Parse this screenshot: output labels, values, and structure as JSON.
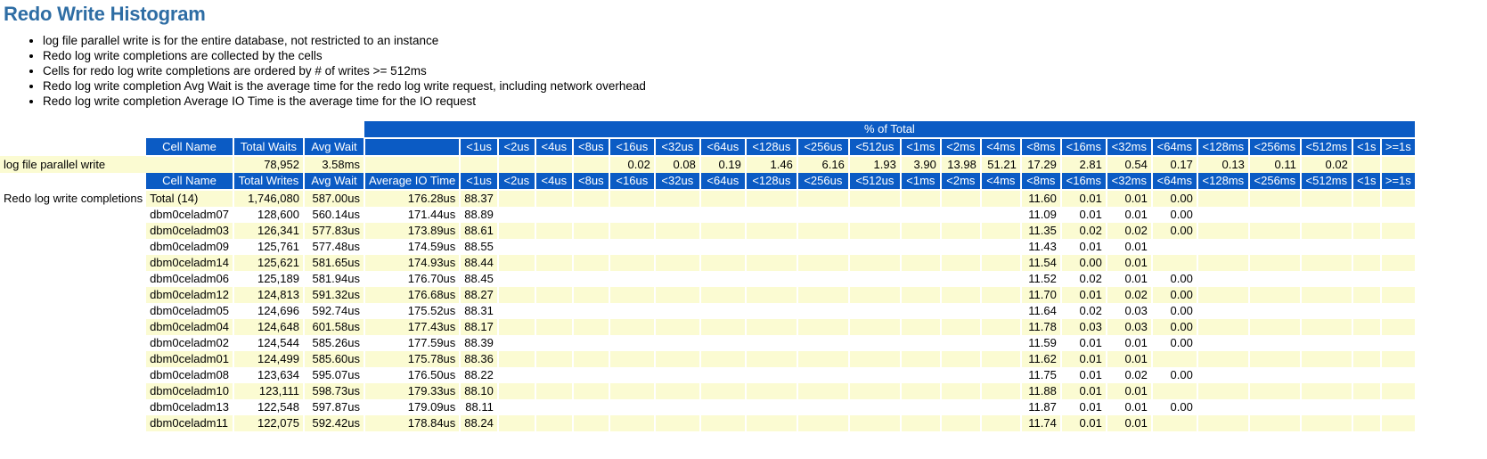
{
  "page": {
    "title": "Redo Write Histogram",
    "title_color": "#2E6DA4",
    "header_bg": "#0B5BC4",
    "row_alt_bg": "#FBFBD2"
  },
  "bullets": [
    "log file parallel write is for the entire database, not restricted to an instance",
    "Redo log write completions are collected by the cells",
    "Cells for redo log write completions are ordered by # of writes >= 512ms",
    "Redo log write completion Avg Wait is the average time for the redo log write request, including network overhead",
    "Redo log write completion Average IO Time is the average time for the IO request"
  ],
  "band": {
    "label": "% of Total"
  },
  "buckets": [
    "<1us",
    "<2us",
    "<4us",
    "<8us",
    "<16us",
    "<32us",
    "<64us",
    "<128us",
    "<256us",
    "<512us",
    "<1ms",
    "<2ms",
    "<4ms",
    "<8ms",
    "<16ms",
    "<32ms",
    "<64ms",
    "<128ms",
    "<256ms",
    "<512ms",
    "<1s",
    ">=1s"
  ],
  "table1": {
    "row_label": "log file parallel write",
    "headers": [
      "Cell Name",
      "Total Waits",
      "Avg Wait",
      ""
    ],
    "row": {
      "cell_name": "",
      "total_waits": "78,952",
      "avg_wait": "3.58ms",
      "blank": "",
      "pct": [
        "",
        "",
        "",
        "",
        "0.02",
        "0.08",
        "0.19",
        "1.46",
        "6.16",
        "1.93",
        "3.90",
        "13.98",
        "51.21",
        "17.29",
        "2.81",
        "0.54",
        "0.17",
        "0.13",
        "0.11",
        "0.02",
        "",
        ""
      ]
    }
  },
  "table2": {
    "row_label": "Redo log write completions",
    "headers": [
      "Cell Name",
      "Total Writes",
      "Avg Wait",
      "Average IO Time"
    ],
    "rows": [
      {
        "cell_name": "Total (14)",
        "total_writes": "1,746,080",
        "avg_wait": "587.00us",
        "avg_io": "176.28us",
        "pct": [
          "88.37",
          "",
          "",
          "",
          "",
          "",
          "",
          "",
          "",
          "",
          "",
          "",
          "",
          "11.60",
          "0.01",
          "0.01",
          "0.00",
          "",
          "",
          "",
          "",
          ""
        ]
      },
      {
        "cell_name": "dbm0celadm07",
        "total_writes": "128,600",
        "avg_wait": "560.14us",
        "avg_io": "171.44us",
        "pct": [
          "88.89",
          "",
          "",
          "",
          "",
          "",
          "",
          "",
          "",
          "",
          "",
          "",
          "",
          "11.09",
          "0.01",
          "0.01",
          "0.00",
          "",
          "",
          "",
          "",
          ""
        ]
      },
      {
        "cell_name": "dbm0celadm03",
        "total_writes": "126,341",
        "avg_wait": "577.83us",
        "avg_io": "173.89us",
        "pct": [
          "88.61",
          "",
          "",
          "",
          "",
          "",
          "",
          "",
          "",
          "",
          "",
          "",
          "",
          "11.35",
          "0.02",
          "0.02",
          "0.00",
          "",
          "",
          "",
          "",
          ""
        ]
      },
      {
        "cell_name": "dbm0celadm09",
        "total_writes": "125,761",
        "avg_wait": "577.48us",
        "avg_io": "174.59us",
        "pct": [
          "88.55",
          "",
          "",
          "",
          "",
          "",
          "",
          "",
          "",
          "",
          "",
          "",
          "",
          "11.43",
          "0.01",
          "0.01",
          "",
          "",
          "",
          "",
          "",
          ""
        ]
      },
      {
        "cell_name": "dbm0celadm14",
        "total_writes": "125,621",
        "avg_wait": "581.65us",
        "avg_io": "174.93us",
        "pct": [
          "88.44",
          "",
          "",
          "",
          "",
          "",
          "",
          "",
          "",
          "",
          "",
          "",
          "",
          "11.54",
          "0.00",
          "0.01",
          "",
          "",
          "",
          "",
          "",
          ""
        ]
      },
      {
        "cell_name": "dbm0celadm06",
        "total_writes": "125,189",
        "avg_wait": "581.94us",
        "avg_io": "176.70us",
        "pct": [
          "88.45",
          "",
          "",
          "",
          "",
          "",
          "",
          "",
          "",
          "",
          "",
          "",
          "",
          "11.52",
          "0.02",
          "0.01",
          "0.00",
          "",
          "",
          "",
          "",
          ""
        ]
      },
      {
        "cell_name": "dbm0celadm12",
        "total_writes": "124,813",
        "avg_wait": "591.32us",
        "avg_io": "176.68us",
        "pct": [
          "88.27",
          "",
          "",
          "",
          "",
          "",
          "",
          "",
          "",
          "",
          "",
          "",
          "",
          "11.70",
          "0.01",
          "0.02",
          "0.00",
          "",
          "",
          "",
          "",
          ""
        ]
      },
      {
        "cell_name": "dbm0celadm05",
        "total_writes": "124,696",
        "avg_wait": "592.74us",
        "avg_io": "175.52us",
        "pct": [
          "88.31",
          "",
          "",
          "",
          "",
          "",
          "",
          "",
          "",
          "",
          "",
          "",
          "",
          "11.64",
          "0.02",
          "0.03",
          "0.00",
          "",
          "",
          "",
          "",
          ""
        ]
      },
      {
        "cell_name": "dbm0celadm04",
        "total_writes": "124,648",
        "avg_wait": "601.58us",
        "avg_io": "177.43us",
        "pct": [
          "88.17",
          "",
          "",
          "",
          "",
          "",
          "",
          "",
          "",
          "",
          "",
          "",
          "",
          "11.78",
          "0.03",
          "0.03",
          "0.00",
          "",
          "",
          "",
          "",
          ""
        ]
      },
      {
        "cell_name": "dbm0celadm02",
        "total_writes": "124,544",
        "avg_wait": "585.26us",
        "avg_io": "177.59us",
        "pct": [
          "88.39",
          "",
          "",
          "",
          "",
          "",
          "",
          "",
          "",
          "",
          "",
          "",
          "",
          "11.59",
          "0.01",
          "0.01",
          "0.00",
          "",
          "",
          "",
          "",
          ""
        ]
      },
      {
        "cell_name": "dbm0celadm01",
        "total_writes": "124,499",
        "avg_wait": "585.60us",
        "avg_io": "175.78us",
        "pct": [
          "88.36",
          "",
          "",
          "",
          "",
          "",
          "",
          "",
          "",
          "",
          "",
          "",
          "",
          "11.62",
          "0.01",
          "0.01",
          "",
          "",
          "",
          "",
          "",
          ""
        ]
      },
      {
        "cell_name": "dbm0celadm08",
        "total_writes": "123,634",
        "avg_wait": "595.07us",
        "avg_io": "176.50us",
        "pct": [
          "88.22",
          "",
          "",
          "",
          "",
          "",
          "",
          "",
          "",
          "",
          "",
          "",
          "",
          "11.75",
          "0.01",
          "0.02",
          "0.00",
          "",
          "",
          "",
          "",
          ""
        ]
      },
      {
        "cell_name": "dbm0celadm10",
        "total_writes": "123,111",
        "avg_wait": "598.73us",
        "avg_io": "179.33us",
        "pct": [
          "88.10",
          "",
          "",
          "",
          "",
          "",
          "",
          "",
          "",
          "",
          "",
          "",
          "",
          "11.88",
          "0.01",
          "0.01",
          "",
          "",
          "",
          "",
          "",
          ""
        ]
      },
      {
        "cell_name": "dbm0celadm13",
        "total_writes": "122,548",
        "avg_wait": "597.87us",
        "avg_io": "179.09us",
        "pct": [
          "88.11",
          "",
          "",
          "",
          "",
          "",
          "",
          "",
          "",
          "",
          "",
          "",
          "",
          "11.87",
          "0.01",
          "0.01",
          "0.00",
          "",
          "",
          "",
          "",
          ""
        ]
      },
      {
        "cell_name": "dbm0celadm11",
        "total_writes": "122,075",
        "avg_wait": "592.42us",
        "avg_io": "178.84us",
        "pct": [
          "88.24",
          "",
          "",
          "",
          "",
          "",
          "",
          "",
          "",
          "",
          "",
          "",
          "",
          "11.74",
          "0.01",
          "0.01",
          "",
          "",
          "",
          "",
          "",
          ""
        ]
      }
    ]
  },
  "chart_data": {
    "type": "table",
    "title": "Redo Write Histogram",
    "categories": [
      "<1us",
      "<2us",
      "<4us",
      "<8us",
      "<16us",
      "<32us",
      "<64us",
      "<128us",
      "<256us",
      "<512us",
      "<1ms",
      "<2ms",
      "<4ms",
      "<8ms",
      "<16ms",
      "<32ms",
      "<64ms",
      "<128ms",
      "<256ms",
      "<512ms",
      "<1s",
      ">=1s"
    ],
    "ylabel": "% of Total",
    "series": [
      {
        "name": "log file parallel write",
        "values": [
          null,
          null,
          null,
          null,
          0.02,
          0.08,
          0.19,
          1.46,
          6.16,
          1.93,
          3.9,
          13.98,
          51.21,
          17.29,
          2.81,
          0.54,
          0.17,
          0.13,
          0.11,
          0.02,
          null,
          null
        ]
      },
      {
        "name": "Redo log write completions Total (14)",
        "values": [
          88.37,
          null,
          null,
          null,
          null,
          null,
          null,
          null,
          null,
          null,
          null,
          null,
          null,
          11.6,
          0.01,
          0.01,
          0.0,
          null,
          null,
          null,
          null,
          null
        ]
      },
      {
        "name": "dbm0celadm07",
        "values": [
          88.89,
          null,
          null,
          null,
          null,
          null,
          null,
          null,
          null,
          null,
          null,
          null,
          null,
          11.09,
          0.01,
          0.01,
          0.0,
          null,
          null,
          null,
          null,
          null
        ]
      },
      {
        "name": "dbm0celadm03",
        "values": [
          88.61,
          null,
          null,
          null,
          null,
          null,
          null,
          null,
          null,
          null,
          null,
          null,
          null,
          11.35,
          0.02,
          0.02,
          0.0,
          null,
          null,
          null,
          null,
          null
        ]
      },
      {
        "name": "dbm0celadm09",
        "values": [
          88.55,
          null,
          null,
          null,
          null,
          null,
          null,
          null,
          null,
          null,
          null,
          null,
          null,
          11.43,
          0.01,
          0.01,
          null,
          null,
          null,
          null,
          null,
          null
        ]
      },
      {
        "name": "dbm0celadm14",
        "values": [
          88.44,
          null,
          null,
          null,
          null,
          null,
          null,
          null,
          null,
          null,
          null,
          null,
          null,
          11.54,
          0.0,
          0.01,
          null,
          null,
          null,
          null,
          null,
          null
        ]
      },
      {
        "name": "dbm0celadm06",
        "values": [
          88.45,
          null,
          null,
          null,
          null,
          null,
          null,
          null,
          null,
          null,
          null,
          null,
          null,
          11.52,
          0.02,
          0.01,
          0.0,
          null,
          null,
          null,
          null,
          null
        ]
      },
      {
        "name": "dbm0celadm12",
        "values": [
          88.27,
          null,
          null,
          null,
          null,
          null,
          null,
          null,
          null,
          null,
          null,
          null,
          null,
          11.7,
          0.01,
          0.02,
          0.0,
          null,
          null,
          null,
          null,
          null
        ]
      },
      {
        "name": "dbm0celadm05",
        "values": [
          88.31,
          null,
          null,
          null,
          null,
          null,
          null,
          null,
          null,
          null,
          null,
          null,
          null,
          11.64,
          0.02,
          0.03,
          0.0,
          null,
          null,
          null,
          null,
          null
        ]
      },
      {
        "name": "dbm0celadm04",
        "values": [
          88.17,
          null,
          null,
          null,
          null,
          null,
          null,
          null,
          null,
          null,
          null,
          null,
          null,
          11.78,
          0.03,
          0.03,
          0.0,
          null,
          null,
          null,
          null,
          null
        ]
      },
      {
        "name": "dbm0celadm02",
        "values": [
          88.39,
          null,
          null,
          null,
          null,
          null,
          null,
          null,
          null,
          null,
          null,
          null,
          null,
          11.59,
          0.01,
          0.01,
          0.0,
          null,
          null,
          null,
          null,
          null
        ]
      },
      {
        "name": "dbm0celadm01",
        "values": [
          88.36,
          null,
          null,
          null,
          null,
          null,
          null,
          null,
          null,
          null,
          null,
          null,
          null,
          11.62,
          0.01,
          0.01,
          null,
          null,
          null,
          null,
          null,
          null
        ]
      },
      {
        "name": "dbm0celadm08",
        "values": [
          88.22,
          null,
          null,
          null,
          null,
          null,
          null,
          null,
          null,
          null,
          null,
          null,
          null,
          11.75,
          0.01,
          0.02,
          0.0,
          null,
          null,
          null,
          null,
          null
        ]
      },
      {
        "name": "dbm0celadm10",
        "values": [
          88.1,
          null,
          null,
          null,
          null,
          null,
          null,
          null,
          null,
          null,
          null,
          null,
          null,
          11.88,
          0.01,
          0.01,
          null,
          null,
          null,
          null,
          null,
          null
        ]
      },
      {
        "name": "dbm0celadm13",
        "values": [
          88.11,
          null,
          null,
          null,
          null,
          null,
          null,
          null,
          null,
          null,
          null,
          null,
          null,
          11.87,
          0.01,
          0.01,
          0.0,
          null,
          null,
          null,
          null,
          null
        ]
      },
      {
        "name": "dbm0celadm11",
        "values": [
          88.24,
          null,
          null,
          null,
          null,
          null,
          null,
          null,
          null,
          null,
          null,
          null,
          null,
          11.74,
          0.01,
          0.01,
          null,
          null,
          null,
          null,
          null,
          null
        ]
      }
    ]
  }
}
